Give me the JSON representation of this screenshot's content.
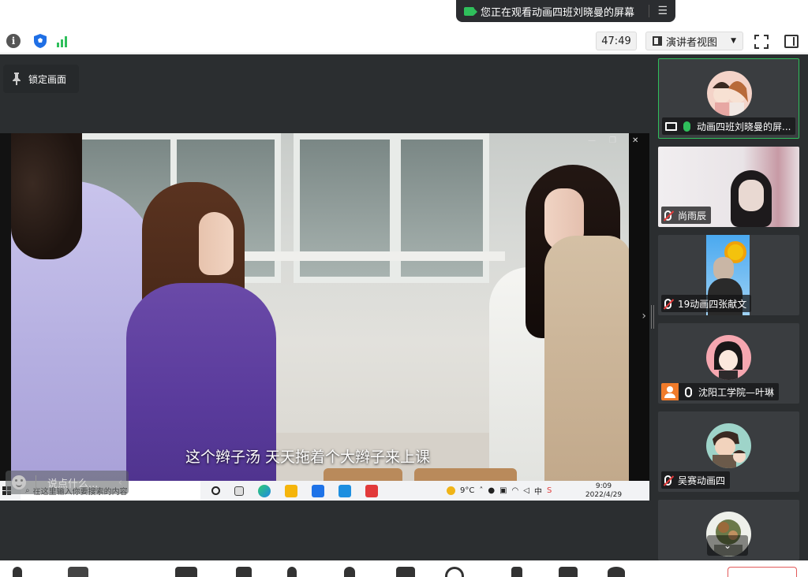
{
  "banner": {
    "text": "您正在观看动画四班刘晓曼的屏幕",
    "share_icon": "screen-share-icon",
    "menu_icon": "menu-icon"
  },
  "toolbar": {
    "info_icon": "info-icon",
    "shield_icon": "shield-icon",
    "signal_icon": "signal-strength-icon",
    "timer": "47:49",
    "view_mode": "演讲者视图",
    "fullscreen_icon": "fullscreen-icon",
    "panel_icon": "side-panel-icon"
  },
  "stage": {
    "lock_label": "锁定画面",
    "subtitle": "这个辫子汤 天天拖着个大辫子来上课",
    "comment_placeholder": "说点什么...",
    "taskbar": {
      "search_placeholder": "在这里输入你要搜索的内容",
      "weather": "9°C",
      "time": "9:09",
      "date": "2022/4/29"
    }
  },
  "participants": [
    {
      "name": "动画四班刘晓曼的屏...",
      "sharing": true,
      "mic": "on",
      "active": true
    },
    {
      "name": "尚雨辰",
      "mic": "muted"
    },
    {
      "name": "19动画四张献文",
      "mic": "muted"
    },
    {
      "name": "沈阳工学院—叶琳",
      "mic": "on-white",
      "host": true
    },
    {
      "name": "吴赛动画四",
      "mic": "muted"
    },
    {
      "name": ""
    }
  ],
  "colors": {
    "accent": "#2fbf5b",
    "stage_bg": "#2b2e30",
    "muted": "#e23a3a",
    "host": "#f07b2a"
  }
}
